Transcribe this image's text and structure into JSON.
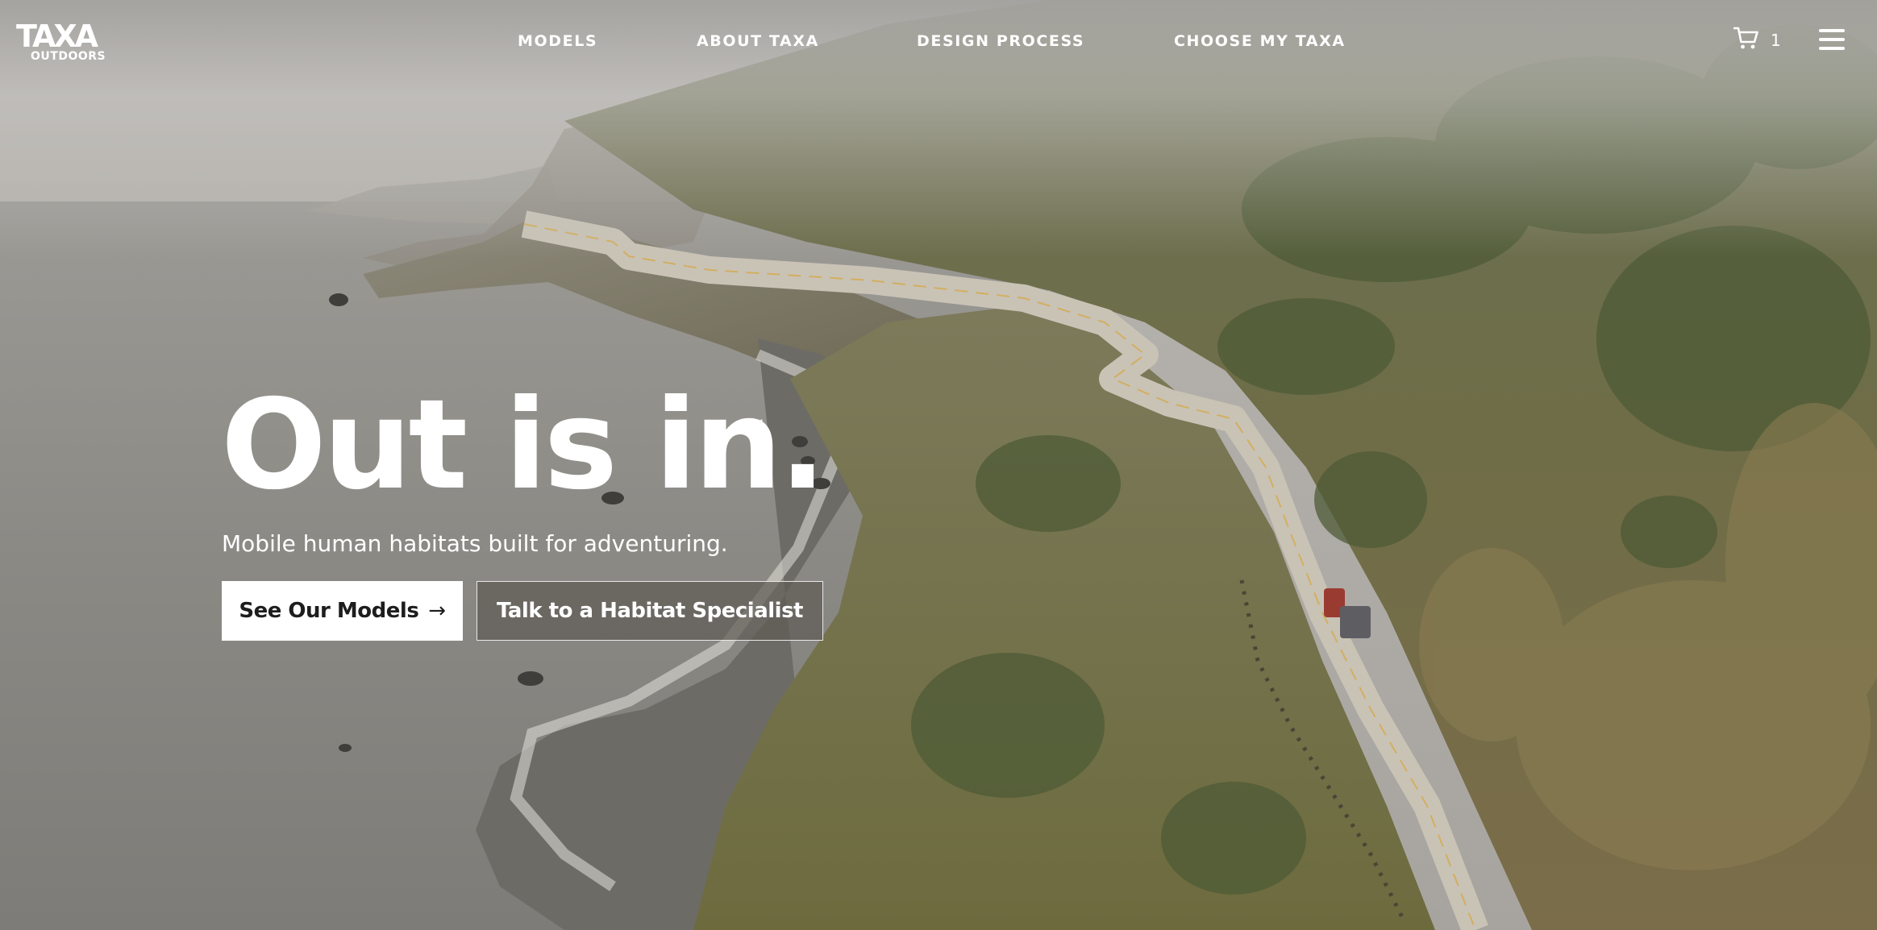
{
  "brand": {
    "logo_mark": "TAXA",
    "logo_sub": "OUTDOORS"
  },
  "nav": {
    "models": "MODELS",
    "about": "ABOUT TAXA",
    "design_process": "DESIGN PROCESS",
    "choose": "CHOOSE MY TAXA"
  },
  "cart": {
    "count": "1",
    "icon": "cart-icon"
  },
  "menu": {
    "icon": "hamburger-menu-icon"
  },
  "hero": {
    "title": "Out is in.",
    "trademark": "™",
    "subtitle": "Mobile human habitats built for adventuring.",
    "primary_cta": "See Our Models",
    "primary_cta_arrow": "→",
    "secondary_cta": "Talk to a Habitat Specialist"
  }
}
